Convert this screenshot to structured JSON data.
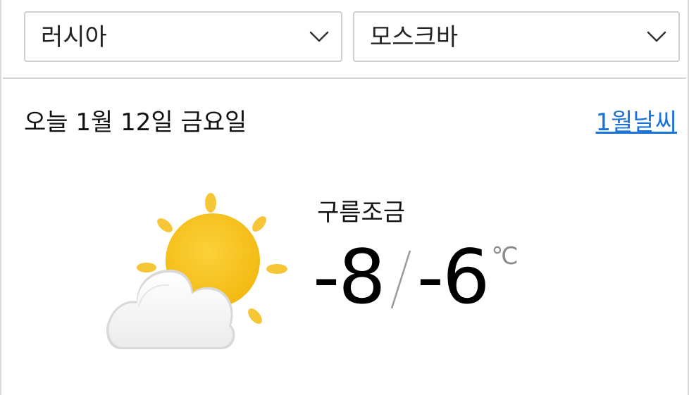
{
  "location": {
    "country": "러시아",
    "city": "모스크바"
  },
  "date_line": "오늘 1월 12일 금요일",
  "month_link": "1월날씨",
  "weather": {
    "condition": "구름조금",
    "low": "-8",
    "high": "-6",
    "unit": "℃",
    "icon": "partly-cloudy-icon"
  },
  "colors": {
    "link": "#1a73d9",
    "sun": "#f7c21b",
    "ray": "#f6c636",
    "cloud": "#f5f5f5"
  },
  "icons": {
    "dropdown": "chevron-down-icon"
  }
}
